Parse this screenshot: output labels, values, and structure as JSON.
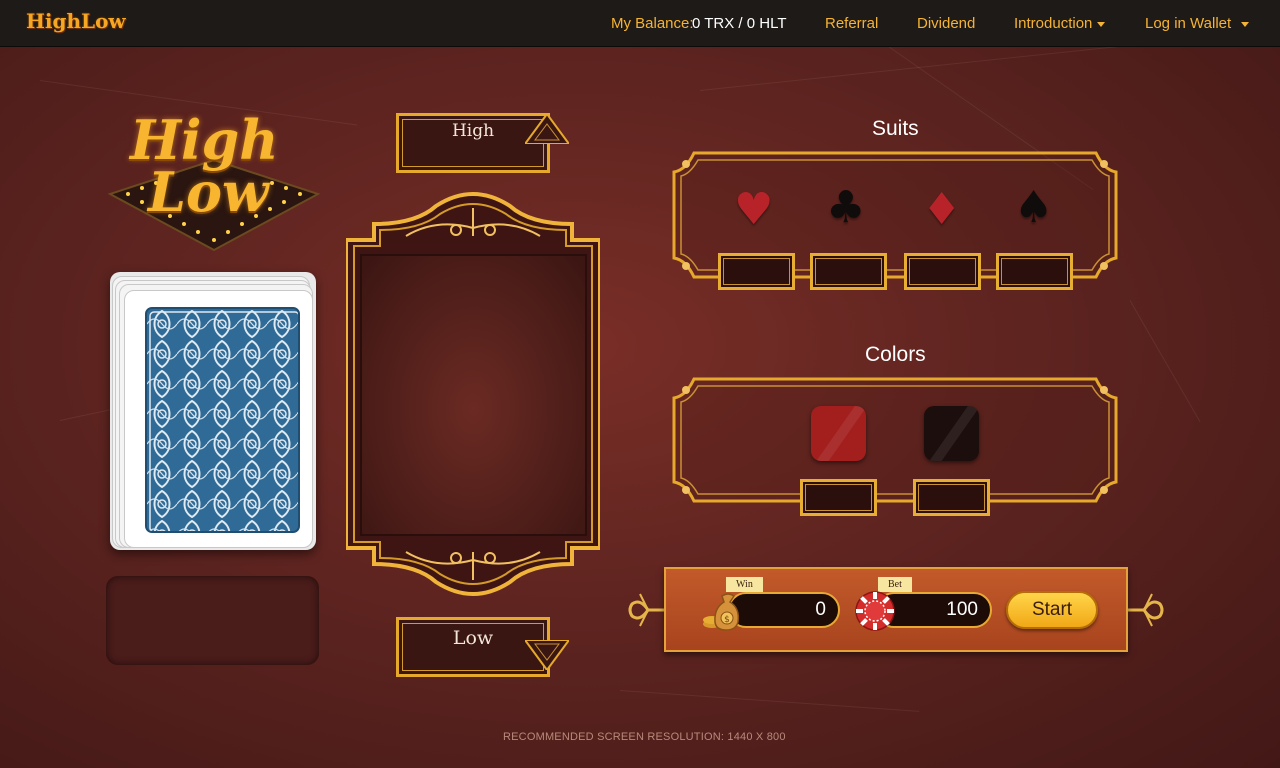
{
  "nav": {
    "logo": "HighLow",
    "balance_label": "My Balance:",
    "balance_value": "0 TRX / 0 HLT",
    "referral": "Referral",
    "dividend": "Dividend",
    "introduction": "Introduction",
    "login": "Log in Wallet"
  },
  "logo": {
    "line1": "High",
    "line2": "Low"
  },
  "buttons": {
    "high": "High",
    "low": "Low"
  },
  "suits": {
    "title": "Suits",
    "items": [
      {
        "name": "hearts",
        "glyph": "♥",
        "color": "#c0232a"
      },
      {
        "name": "clubs",
        "glyph": "♣",
        "color": "#111111"
      },
      {
        "name": "diamonds",
        "glyph": "♦",
        "color": "#c0232a"
      },
      {
        "name": "spades",
        "glyph": "♠",
        "color": "#111111"
      }
    ]
  },
  "colors": {
    "title": "Colors",
    "items": [
      {
        "name": "red",
        "color": "#a61e1e"
      },
      {
        "name": "black",
        "color": "#1a0f0f"
      }
    ]
  },
  "bet_bar": {
    "win_label": "Win",
    "win_value": "0",
    "bet_label": "Bet",
    "bet_value": "100",
    "start": "Start"
  },
  "footer": "RECOMMENDED SCREEN RESOLUTION: 1440 X 800",
  "palette": {
    "gold": "#e8ae33",
    "background": "#5e2420",
    "nav": "#1e1a18"
  }
}
